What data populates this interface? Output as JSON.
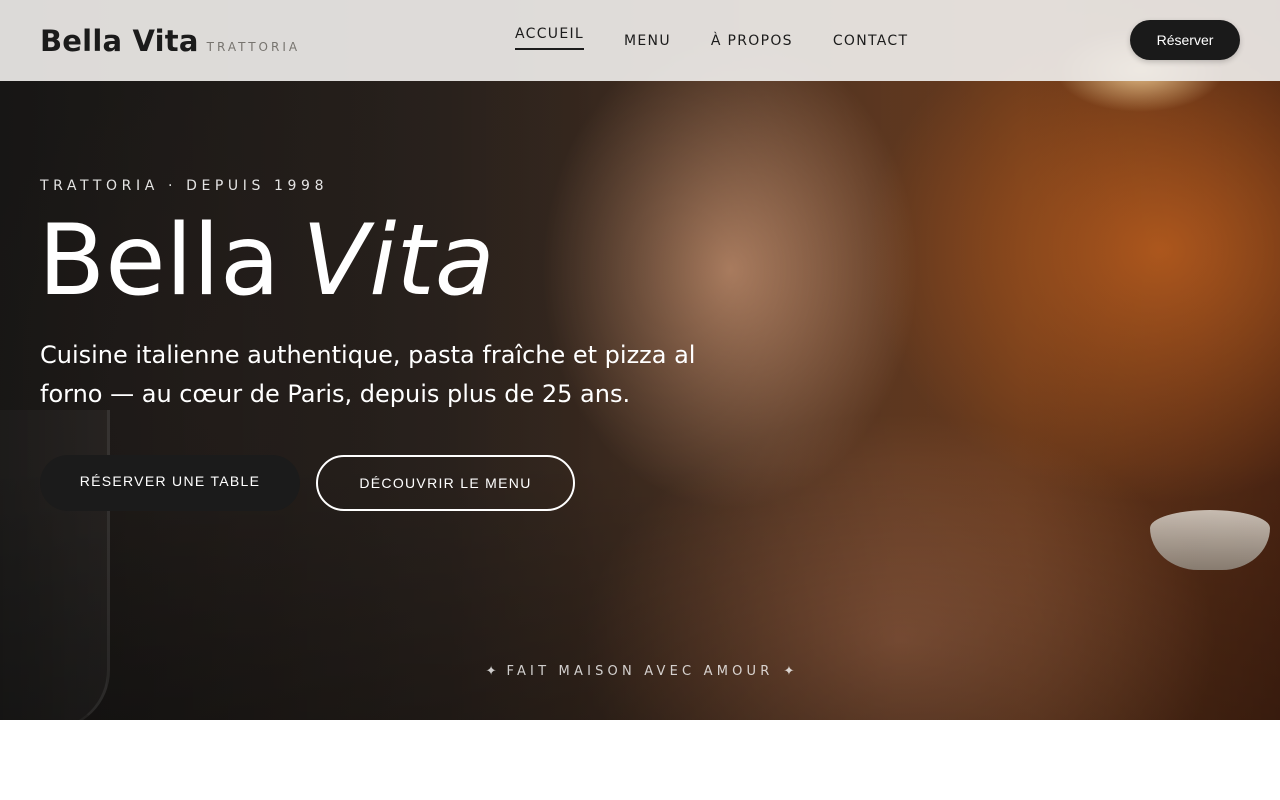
{
  "header": {
    "brand_name": "Bella Vita",
    "brand_tag": "TRATTORIA",
    "nav": [
      {
        "label": "ACCUEIL",
        "active": true
      },
      {
        "label": "MENU",
        "active": false
      },
      {
        "label": "À PROPOS",
        "active": false
      },
      {
        "label": "CONTACT",
        "active": false
      }
    ],
    "reserve_label": "Réserver"
  },
  "hero": {
    "eyebrow": "TRATTORIA · DEPUIS 1998",
    "title_main": "Bella",
    "title_italic": "Vita",
    "description": "Cuisine italienne authentique, pasta fraîche et pizza al forno — au cœur de Paris, depuis plus de 25 ans.",
    "primary_cta": "RÉSERVER UNE TABLE",
    "secondary_cta": "DÉCOUVRIR LE MENU",
    "tagline": "FAIT MAISON AVEC AMOUR",
    "tagline_icon": "sparkle-icon"
  },
  "colors": {
    "brand_dark": "#1b1b1b",
    "header_bg": "#eeece9",
    "text_light": "#ffffff"
  }
}
